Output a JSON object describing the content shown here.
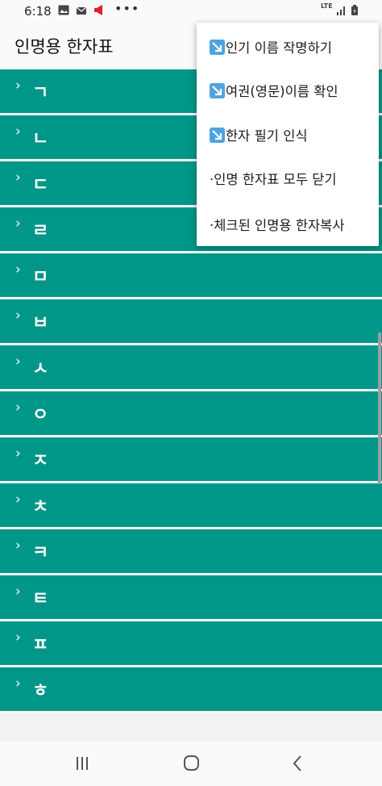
{
  "status_bar": {
    "time": "6:18",
    "icons": [
      "image-icon",
      "mail-icon",
      "megaphone-icon",
      "more-dots-icon",
      "lte-icon",
      "signal-icon",
      "battery-icon"
    ],
    "dots": "•••",
    "lte_label": "LTE"
  },
  "app_bar": {
    "title": "인명용 한자표"
  },
  "list": {
    "chevron": "›",
    "rows": [
      "ㄱ",
      "ㄴ",
      "ㄷ",
      "ㄹ",
      "ㅁ",
      "ㅂ",
      "ㅅ",
      "ㅇ",
      "ㅈ",
      "ㅊ",
      "ㅋ",
      "ㅌ",
      "ㅍ",
      "ㅎ"
    ]
  },
  "menu": {
    "items": [
      {
        "label": "인기 이름 작명하기",
        "icon": "arrow-down-right-icon"
      },
      {
        "label": "여권(영문)이름 확인",
        "icon": "arrow-down-right-icon"
      },
      {
        "label": "한자 필기 인식",
        "icon": "arrow-down-right-icon"
      },
      {
        "label": "·인명 한자표 모두 닫기",
        "icon": null
      },
      {
        "label": "·체크된 인명용 한자복사",
        "icon": null
      }
    ]
  },
  "colors": {
    "row_bg": "#009688",
    "accent_icon": "#4fa3e0",
    "notification_red": "#e02020"
  },
  "nav_bar": {
    "buttons": [
      "recent-apps-icon",
      "home-icon",
      "back-icon"
    ]
  }
}
